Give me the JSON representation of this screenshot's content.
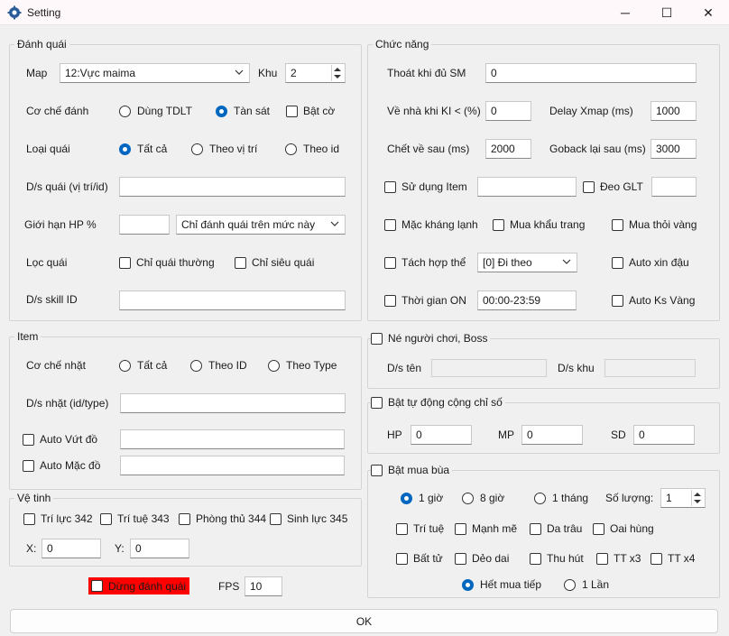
{
  "window": {
    "title": "Setting",
    "minimize": "─",
    "maximize": "☐",
    "close": "✕"
  },
  "danh_quai": {
    "title": "Đánh quái",
    "map_label": "Map",
    "map_value": "12:Vực maima",
    "khu_label": "Khu",
    "khu_value": "2",
    "co_che_label": "Cơ chế đánh",
    "co_che_options": [
      "Dùng TDLT",
      "Tàn sát"
    ],
    "co_che_selected": "Tàn sát",
    "bat_co": "Bật cờ",
    "loai_quai_label": "Loại quái",
    "loai_quai_options": [
      "Tất cả",
      "Theo vị trí",
      "Theo id"
    ],
    "loai_quai_selected": "Tất cả",
    "ds_quai_label": "D/s quái (vị trí/id)",
    "ds_quai_value": "",
    "gioi_han_hp_label": "Giới hạn HP %",
    "gioi_han_hp_value": "",
    "gioi_han_hp_mode": "Chỉ đánh quái trên mức này",
    "loc_quai_label": "Lọc quái",
    "chi_quai_thuong": "Chỉ quái thường",
    "chi_sieu_quai": "Chỉ siêu quái",
    "ds_skill_label": "D/s skill ID",
    "ds_skill_value": ""
  },
  "item": {
    "title": "Item",
    "co_che_nhat_label": "Cơ chế nhặt",
    "options": [
      "Tất cả",
      "Theo ID",
      "Theo Type"
    ],
    "ds_nhat_label": "D/s nhặt (id/type)",
    "ds_nhat_value": "",
    "auto_vut_do": "Auto Vứt đồ",
    "auto_vut_do_value": "",
    "auto_mac_do": "Auto Mặc đồ",
    "auto_mac_do_value": ""
  },
  "ve_tinh": {
    "title": "Vệ tinh",
    "items": [
      "Trí lực 342",
      "Trí tuệ 343",
      "Phòng thủ 344",
      "Sinh lực 345"
    ],
    "x_label": "X:",
    "x_value": "0",
    "y_label": "Y:",
    "y_value": "0"
  },
  "bottom": {
    "dung_danh_quai": "Dừng đánh quái",
    "fps_label": "FPS",
    "fps_value": "10",
    "ok": "OK"
  },
  "chuc_nang": {
    "title": "Chức năng",
    "thoat_label": "Thoát khi đủ SM",
    "thoat_value": "0",
    "ve_nha_label": "Về nhà khi KI < (%)",
    "ve_nha_value": "0",
    "delay_xmap_label": "Delay Xmap (ms)",
    "delay_xmap_value": "1000",
    "chet_ve_label": "Chết về sau (ms)",
    "chet_ve_value": "2000",
    "goback_label": "Goback lại sau (ms)",
    "goback_value": "3000",
    "su_dung_item": "Sử dụng Item",
    "su_dung_item_value": "",
    "deo_glt": "Đeo GLT",
    "deo_glt_value": "",
    "mac_khang_lanh": "Mặc kháng lạnh",
    "mua_khau_trang": "Mua khẩu trang",
    "mua_thoi_vang": "Mua thỏi vàng",
    "tach_hop_the": "Tách hợp thể",
    "tach_hop_the_value": "[0] Đi theo",
    "auto_xin_dau": "Auto xin đậu",
    "thoi_gian_on": "Thời gian ON",
    "thoi_gian_on_value": "00:00-23:59",
    "auto_ks_vang": "Auto Ks Vàng"
  },
  "ne_nguoi_choi": {
    "title": "Né người chơi, Boss",
    "ds_ten_label": "D/s tên",
    "ds_khu_label": "D/s khu"
  },
  "cong_chi_so": {
    "title": "Bật tự động cộng chỉ số",
    "hp_label": "HP",
    "hp_value": "0",
    "mp_label": "MP",
    "mp_value": "0",
    "sd_label": "SD",
    "sd_value": "0"
  },
  "mua_bua": {
    "title": "Bật mua bùa",
    "durations": [
      "1 giờ",
      "8 giờ",
      "1 tháng"
    ],
    "duration_selected": "1 giờ",
    "so_luong_label": "Số lượng:",
    "so_luong_value": "1",
    "row1": [
      "Trí tuệ",
      "Mạnh mẽ",
      "Da trâu",
      "Oai hùng"
    ],
    "row2": [
      "Bất tử",
      "Dẻo dai",
      "Thu hút",
      "TT x3",
      "TT x4"
    ],
    "end_options": [
      "Hết mua tiếp",
      "1 Lần"
    ],
    "end_selected": "Hết mua tiếp"
  },
  "colors": {
    "accent": "#0067c0",
    "stop_bg": "#ff0000"
  },
  "icons": {
    "app": "gear-app-icon",
    "dropdown": "chevron-down-icon"
  }
}
